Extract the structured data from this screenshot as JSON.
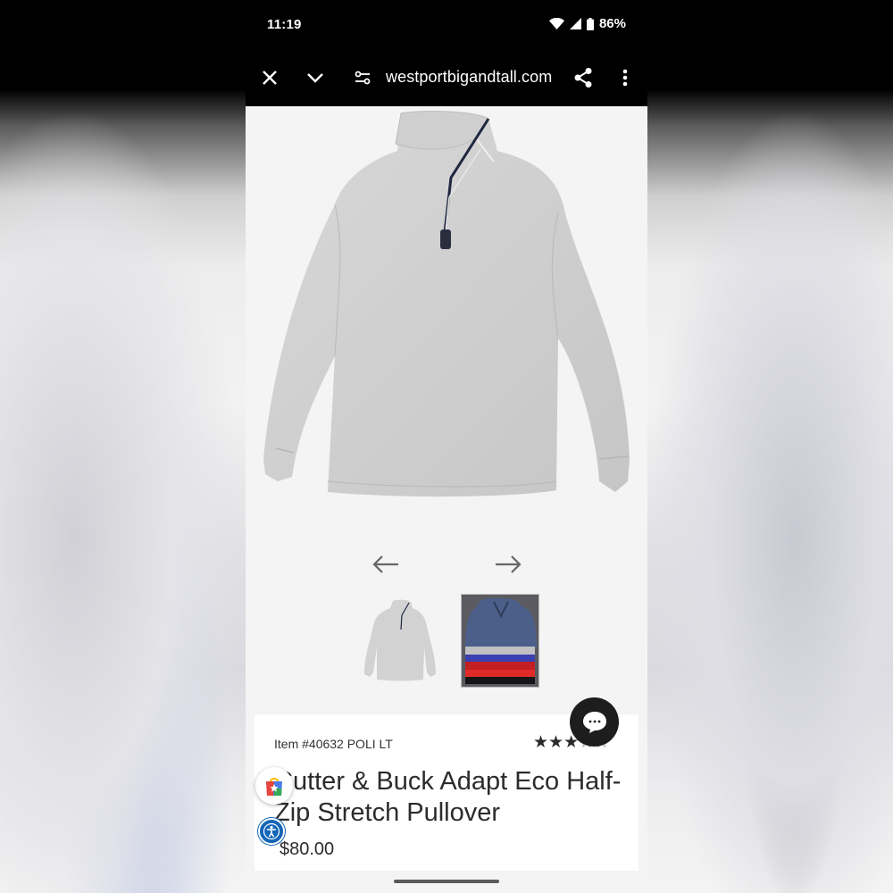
{
  "status_bar": {
    "time": "11:19",
    "battery": "86%",
    "icons": [
      "wifi-icon",
      "signal-icon",
      "battery-icon"
    ]
  },
  "browser": {
    "url": "westportbigandtall.com",
    "icons": [
      "close-icon",
      "chevron-down-icon",
      "site-settings-icon",
      "share-icon",
      "more-vert-icon"
    ]
  },
  "product": {
    "item_number": "Item #40632 POLI LT",
    "title": "Cutter & Buck Adapt Eco Half-Zip Stretch Pullover",
    "price": "$80.00",
    "rating": 3,
    "rating_max": 5
  },
  "gallery": {
    "prev_icon": "arrow-left-icon",
    "next_icon": "arrow-right-icon",
    "thumbnails": [
      "grey-pullover-thumbnail",
      "blue-pullover-stack-thumbnail"
    ]
  },
  "colors": {
    "chrome": "#000000",
    "page_bg": "#f4f4f4",
    "text": "#2c2c2c",
    "accessibility_blue": "#1466b8",
    "chat_button": "#1d1d1d"
  }
}
